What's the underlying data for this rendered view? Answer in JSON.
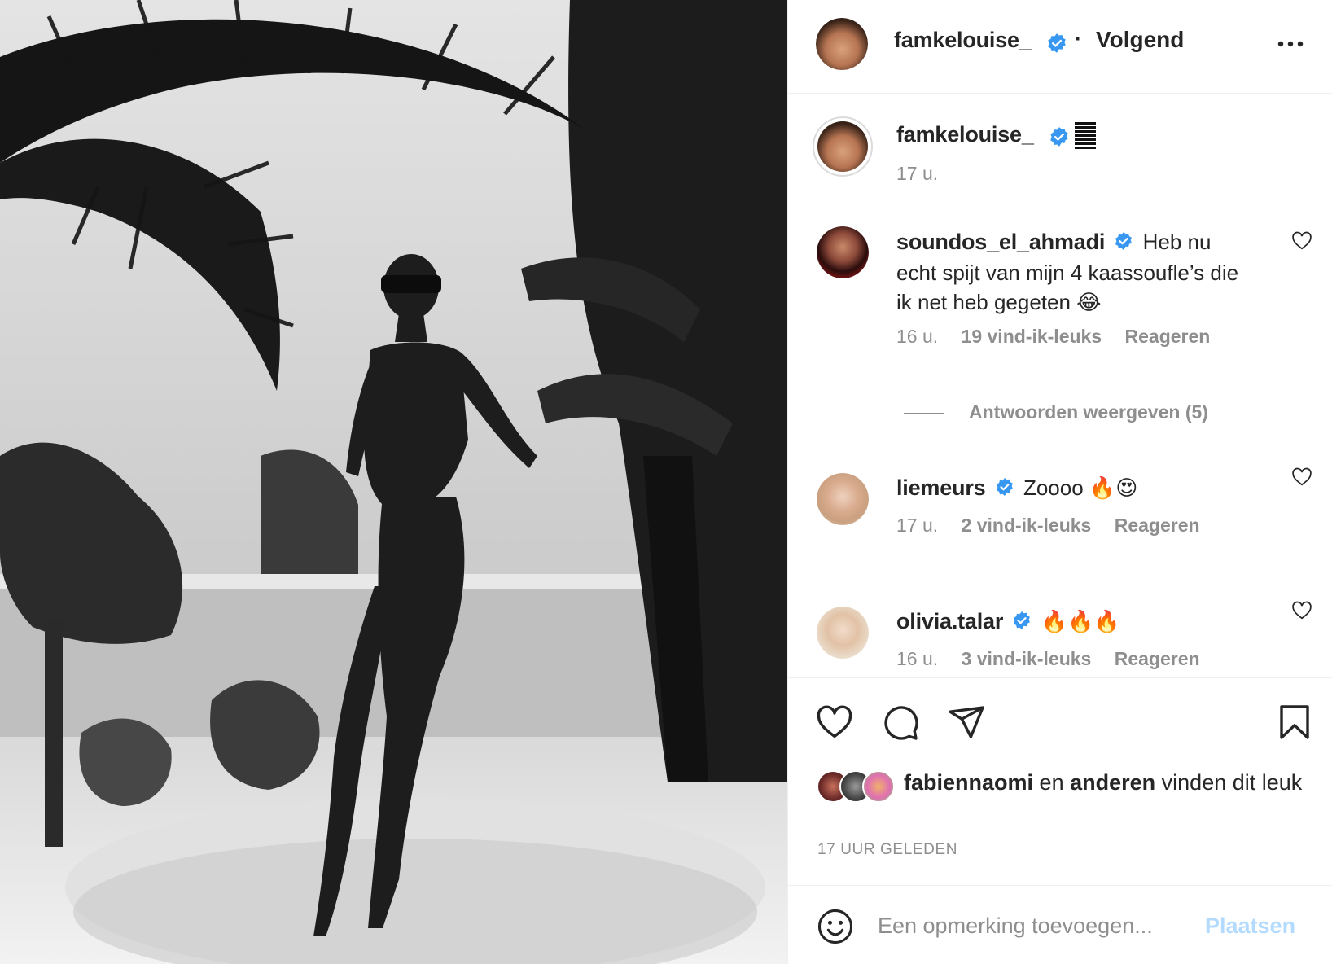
{
  "post": {
    "author": "famkelouise_",
    "follow_status": "Volgend",
    "caption_time": "17 u.",
    "image_alt": "Black and white photo of a woman in a bikini under palm trees"
  },
  "comments": [
    {
      "username": "soundos_el_ahmadi",
      "text": "Heb nu echt spijt van mijn 4 kaassoufle’s die ik net heb gegeten 😂",
      "time": "16 u.",
      "likes": "19 vind-ik-leuks",
      "reply": "Reageren"
    },
    {
      "username": "liemeurs",
      "text": "Zoooo 🔥😍",
      "time": "17 u.",
      "likes": "2 vind-ik-leuks",
      "reply": "Reageren"
    },
    {
      "username": "olivia.talar",
      "text": "🔥🔥🔥",
      "time": "16 u.",
      "likes": "3 vind-ik-leuks",
      "reply": "Reageren"
    }
  ],
  "replies_toggle": "Antwoorden weergeven (5)",
  "likes_summary": {
    "user": "fabiennaomi",
    "connector": "en",
    "others": "anderen",
    "suffix": "vinden dit leuk"
  },
  "timestamp": "17 UUR GELEDEN",
  "add_comment": {
    "placeholder": "Een opmerking toevoegen...",
    "post_label": "Plaatsen"
  },
  "icons": {
    "verified": "verified-badge-icon",
    "more": "more-options-icon",
    "like": "heart-icon",
    "comment": "comment-bubble-icon",
    "share": "paper-plane-icon",
    "save": "bookmark-icon",
    "emoji": "smiley-icon"
  },
  "colors": {
    "verified_blue": "#3897f0",
    "text": "#262626",
    "muted": "#8e8e8e",
    "post_button_disabled": "#b3dbff"
  }
}
